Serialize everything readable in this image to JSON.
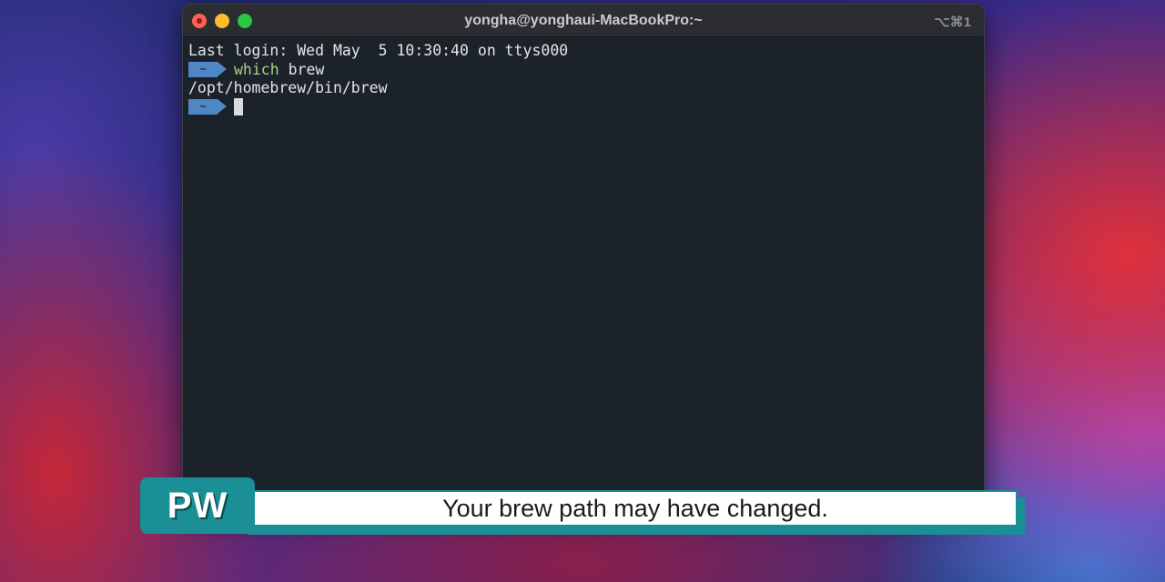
{
  "window": {
    "title": "yongha@yonghaui-MacBookPro:~",
    "shortcut": "⌥⌘1"
  },
  "terminal": {
    "last_login": "Last login: Wed May  5 10:30:40 on ttys000",
    "prompt_symbol": "~",
    "command_name": "which",
    "command_args": " brew",
    "output": "/opt/homebrew/bin/brew"
  },
  "caption": {
    "badge": "PW",
    "text": "Your brew path may have changed."
  },
  "colors": {
    "terminal_bg": "#1b2229",
    "prompt_blue": "#4f86c6",
    "command_green": "#a6d189",
    "caption_teal": "#1a8f96"
  }
}
